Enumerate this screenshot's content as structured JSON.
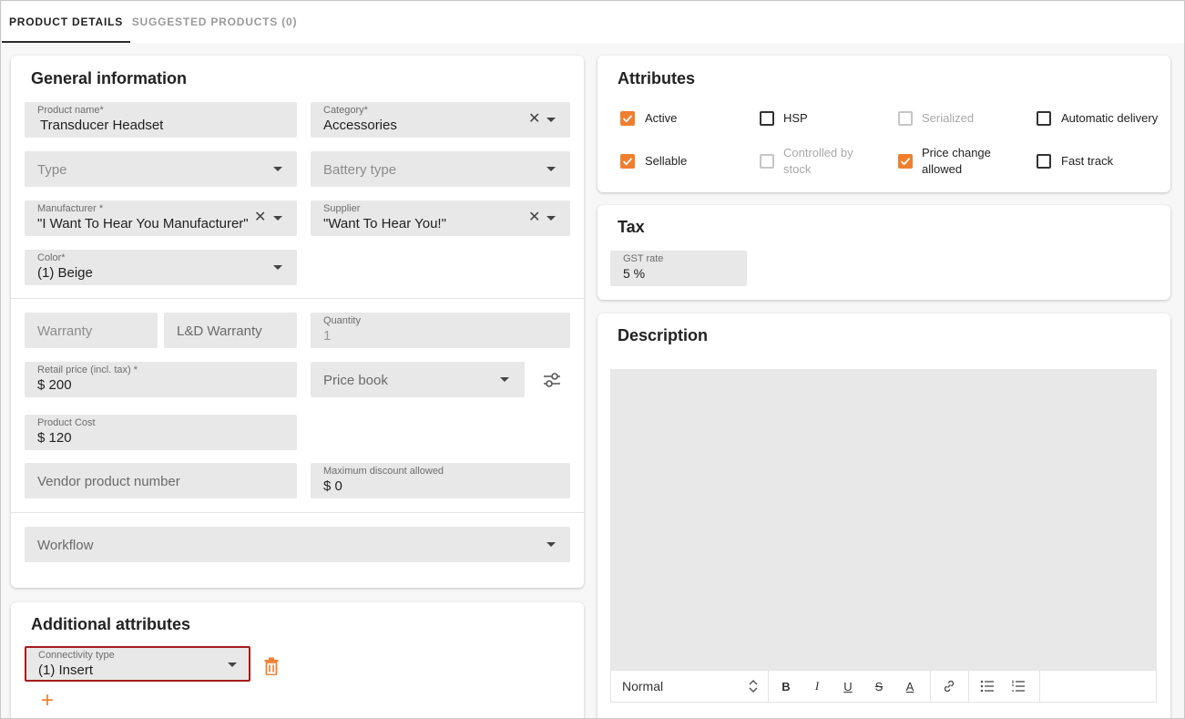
{
  "tabs": [
    {
      "label": "PRODUCT DETAILS"
    },
    {
      "label": "SUGGESTED PRODUCTS (0)"
    }
  ],
  "general": {
    "title": "General information",
    "product_name": {
      "label": "Product name*",
      "value": "Transducer Headset"
    },
    "category": {
      "label": "Category*",
      "value": "Accessories"
    },
    "type": {
      "placeholder": "Type"
    },
    "battery_type": {
      "placeholder": "Battery type"
    },
    "manufacturer": {
      "label": "Manufacturer *",
      "value": "\"I Want To Hear You Manufacturer\""
    },
    "supplier": {
      "label": "Supplier",
      "value": "\"Want To Hear You!\""
    },
    "color": {
      "label": "Color*",
      "value": "(1) Beige"
    },
    "warranty": {
      "placeholder": "Warranty"
    },
    "ld_warranty": {
      "placeholder": "L&D Warranty"
    },
    "quantity": {
      "label": "Quantity",
      "value": "1"
    },
    "retail_price": {
      "label": "Retail price (incl. tax) *",
      "value": "$ 200"
    },
    "price_book": {
      "placeholder": "Price book"
    },
    "product_cost": {
      "label": "Product Cost",
      "value": "$ 120"
    },
    "vendor_product_number": {
      "placeholder": "Vendor product number"
    },
    "max_discount": {
      "label": "Maximum discount allowed",
      "value": "$ 0"
    },
    "workflow": {
      "placeholder": "Workflow"
    }
  },
  "additional": {
    "title": "Additional attributes",
    "connectivity": {
      "label": "Connectivity type",
      "value": "(1) Insert"
    },
    "add_symbol": "+"
  },
  "attributes": {
    "title": "Attributes",
    "items": [
      {
        "label": "Active",
        "state": "checked"
      },
      {
        "label": "HSP",
        "state": "unchecked"
      },
      {
        "label": "Serialized",
        "state": "disabled"
      },
      {
        "label": "Automatic delivery",
        "state": "unchecked"
      },
      {
        "label": "Sellable",
        "state": "checked"
      },
      {
        "label": "Controlled by stock",
        "state": "disabled"
      },
      {
        "label": "Price change allowed",
        "state": "checked"
      },
      {
        "label": "Fast track",
        "state": "unchecked"
      }
    ]
  },
  "tax": {
    "title": "Tax",
    "gst": {
      "label": "GST rate",
      "value": "5 %"
    }
  },
  "description": {
    "title": "Description",
    "style_select": "Normal",
    "toolbar": {
      "bold": "B",
      "italic": "I",
      "underline": "U",
      "strike": "S",
      "color": "A"
    }
  },
  "colors": {
    "accent": "#ef7f2f",
    "error_border": "#a51c1c",
    "field_bg": "#e8e8e8"
  }
}
